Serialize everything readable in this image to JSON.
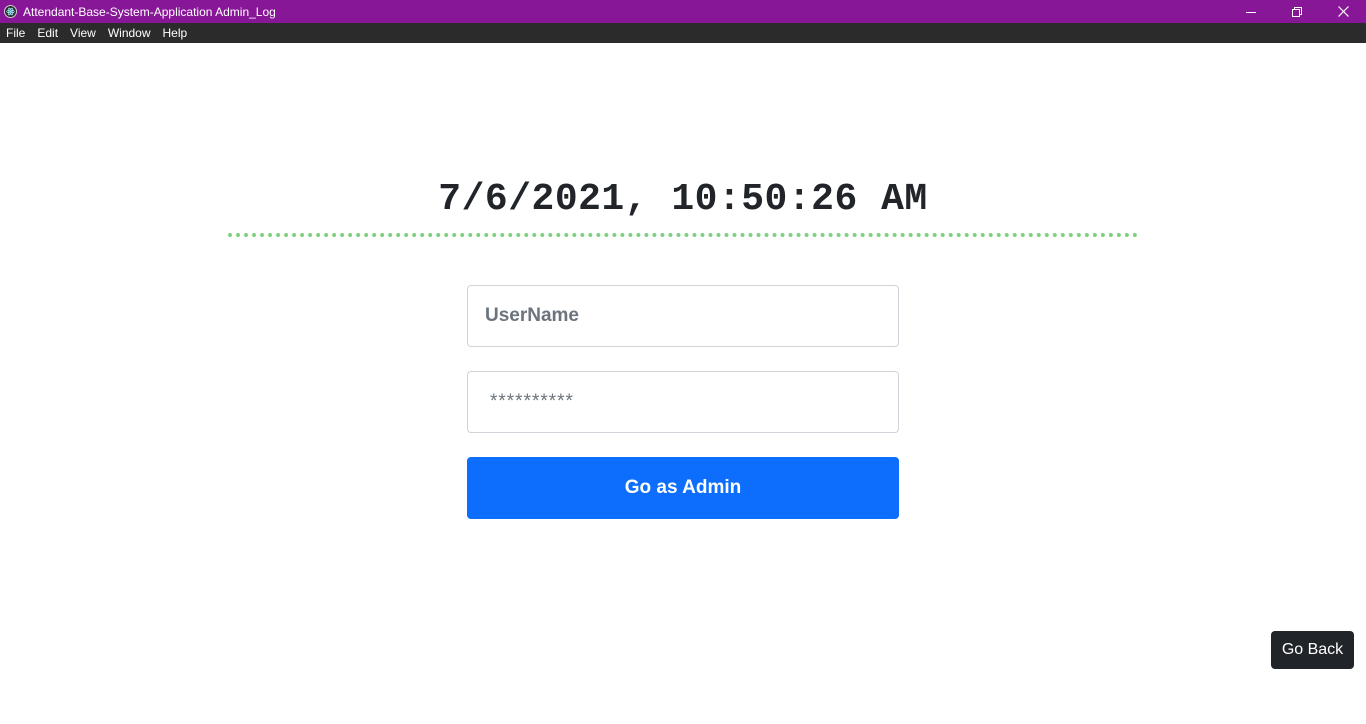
{
  "window": {
    "title": "Attendant-Base-System-Application Admin_Log",
    "icon": "electron-app-icon",
    "controls": [
      "minimize-icon",
      "restore-icon",
      "close-icon"
    ]
  },
  "menubar": {
    "items": [
      "File",
      "Edit",
      "View",
      "Window",
      "Help"
    ]
  },
  "clock": {
    "datetime": "7/6/2021, 10:50:26 AM",
    "underline_color": "#7ed07e"
  },
  "form": {
    "username_value": "UserName",
    "password_value": "**********",
    "submit_label": "Go as Admin"
  },
  "footer": {
    "back_label": "Go Back"
  },
  "colors": {
    "titlebar": "#881798",
    "menubar": "#2b2b2b",
    "primary_button": "#0d6efd",
    "dark_button": "#212529"
  }
}
